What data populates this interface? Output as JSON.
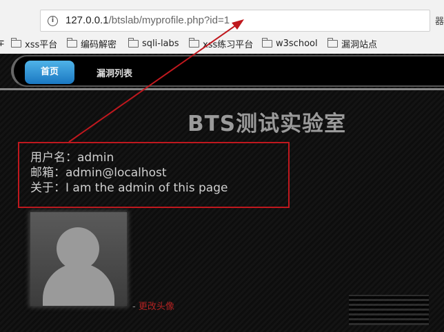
{
  "browser": {
    "url_host": "127.0.0.1",
    "url_rest": "/btslab/myprofile.php?id=1",
    "right_glyph": "器",
    "bookmarks": [
      {
        "label": "xss平台"
      },
      {
        "label": "编码解密"
      },
      {
        "label": "sqli-labs"
      },
      {
        "label": "xss练习平台"
      },
      {
        "label": "w3school"
      },
      {
        "label": "漏洞站点"
      }
    ],
    "left_cut_glyph": "∓"
  },
  "nav": {
    "home": "首页",
    "vulns": "漏洞列表"
  },
  "site": {
    "title": "BTS测试实验室"
  },
  "profile": {
    "username_line": "用户名：admin",
    "email_line": "邮箱：admin@localhost",
    "about_line": "关于：I am the admin of this page"
  },
  "avatar": {
    "dash": "- ",
    "change_label": "更改头像"
  },
  "colors": {
    "annotation": "#c0181e",
    "home_button": "#2a8fd6"
  }
}
